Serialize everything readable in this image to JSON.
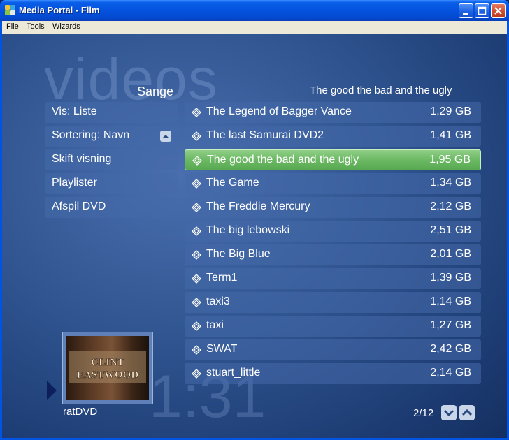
{
  "window": {
    "title": "Media Portal - Film"
  },
  "menu": [
    "File",
    "Tools",
    "Wizards"
  ],
  "background": {
    "title": "videos",
    "clock": "1:31"
  },
  "header": {
    "view_title": "Sange",
    "selected_title": "The good the bad and the ugly"
  },
  "left_menu": [
    {
      "label": "Vis: Liste"
    },
    {
      "label": "Sortering: Navn",
      "icon": "sort-ascending-icon"
    },
    {
      "label": "Skift visning"
    },
    {
      "label": "Playlister"
    },
    {
      "label": "Afspil DVD"
    }
  ],
  "list": [
    {
      "name": "The Legend of Bagger Vance",
      "size": "1,29 GB"
    },
    {
      "name": "The last Samurai DVD2",
      "size": "1,41 GB"
    },
    {
      "name": "The good the bad and the ugly",
      "size": "1,95 GB",
      "selected": true
    },
    {
      "name": "The Game",
      "size": "1,34 GB"
    },
    {
      "name": "The Freddie Mercury",
      "size": "2,12 GB"
    },
    {
      "name": "The big lebowski",
      "size": "2,51 GB"
    },
    {
      "name": "The Big Blue",
      "size": "2,01 GB"
    },
    {
      "name": "Term1",
      "size": "1,39 GB"
    },
    {
      "name": "taxi3",
      "size": "1,14 GB"
    },
    {
      "name": "taxi",
      "size": "1,27 GB"
    },
    {
      "name": "SWAT",
      "size": "2,42 GB"
    },
    {
      "name": "stuart_little",
      "size": "2,14 GB"
    }
  ],
  "thumbnail": {
    "caption": "ratDVD",
    "image_text_1": "CLINT",
    "image_text_2": "EASTWOOD"
  },
  "pager": {
    "text": "2/12"
  },
  "colors": {
    "selected_row": "#6cb964",
    "row_bg": "#4669aa",
    "titlebar": "#0453de"
  }
}
